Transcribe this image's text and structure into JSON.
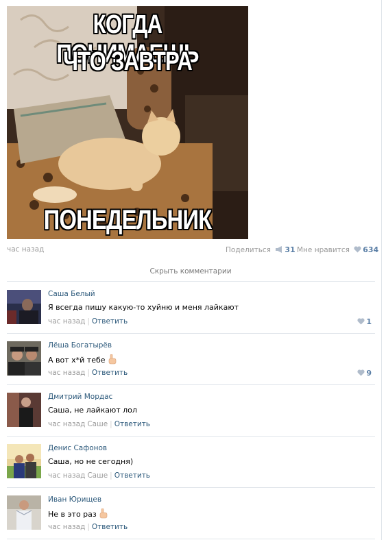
{
  "post": {
    "meme": {
      "top_line1": "КОГДА ПОНИМАЕШЬ",
      "top_line2": "ЧТО ЗАВТРА",
      "bottom_line": "ПОНЕДЕЛЬНИК"
    },
    "time": "час назад",
    "share_label": "Поделиться",
    "share_count": "31",
    "like_label": "Мне нравится",
    "like_count": "634",
    "hide_comments": "Скрыть комментарии"
  },
  "comments": [
    {
      "author": "Саша Белый",
      "text": "Я всегда пишу какую-то хуйню и меня лайкают",
      "time": "час назад",
      "reply_to": "",
      "reply": "Ответить",
      "likes": "1"
    },
    {
      "author": "Лёша Богатырёв",
      "text": "А вот х*й тебе",
      "time": "час назад",
      "reply_to": "",
      "reply": "Ответить",
      "likes": "9"
    },
    {
      "author": "Дмитрий Мордас",
      "text": "Саша, не лайкают лол",
      "time": "час назад",
      "reply_to": "Саше",
      "reply": "Ответить",
      "likes": ""
    },
    {
      "author": "Денис Сафонов",
      "text": "Саша, но не сегодня)",
      "time": "час назад",
      "reply_to": "Саше",
      "reply": "Ответить",
      "likes": ""
    },
    {
      "author": "Иван Юрищев",
      "text": "Не в это раз",
      "time": "час назад",
      "reply_to": "",
      "reply": "Ответить",
      "likes": ""
    }
  ],
  "colors": {
    "link": "#2b587a",
    "muted": "#999999",
    "like_count": "#5b7fa6",
    "divider": "#dfe4ea"
  },
  "icons": [
    "megaphone-icon",
    "heart-icon",
    "finger-pointing-up-icon"
  ]
}
